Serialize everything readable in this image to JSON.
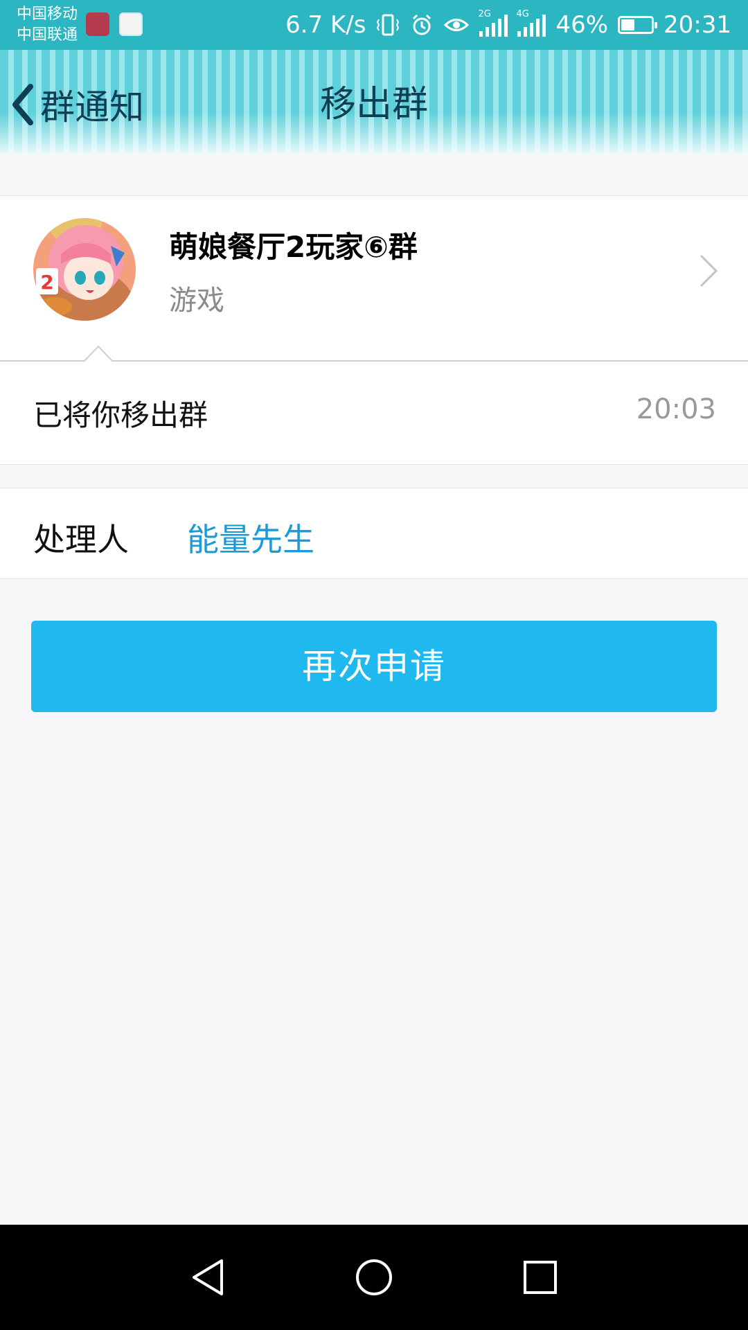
{
  "status_bar": {
    "carrier_1": "中国移动",
    "carrier_2": "中国联通",
    "net_speed": "6.7 K/s",
    "sim1_tag": "2G",
    "sim2_tag": "4G",
    "battery_percent": "46%",
    "battery_level": 0.46,
    "time": "20:31"
  },
  "header": {
    "back_label": "群通知",
    "title": "移出群"
  },
  "group": {
    "name": "萌娘餐厅2玩家⑥群",
    "category": "游戏",
    "avatar_badge": "2"
  },
  "notice": {
    "text": "已将你移出群",
    "time": "20:03"
  },
  "handler": {
    "label": "处理人",
    "name": "能量先生"
  },
  "actions": {
    "reapply_label": "再次申请"
  },
  "colors": {
    "status_bar": "#2bb6c2",
    "header_text": "#0f3f55",
    "link_blue": "#1a9ad6",
    "button_blue": "#20b9ef",
    "background": "#f7f7f9"
  }
}
